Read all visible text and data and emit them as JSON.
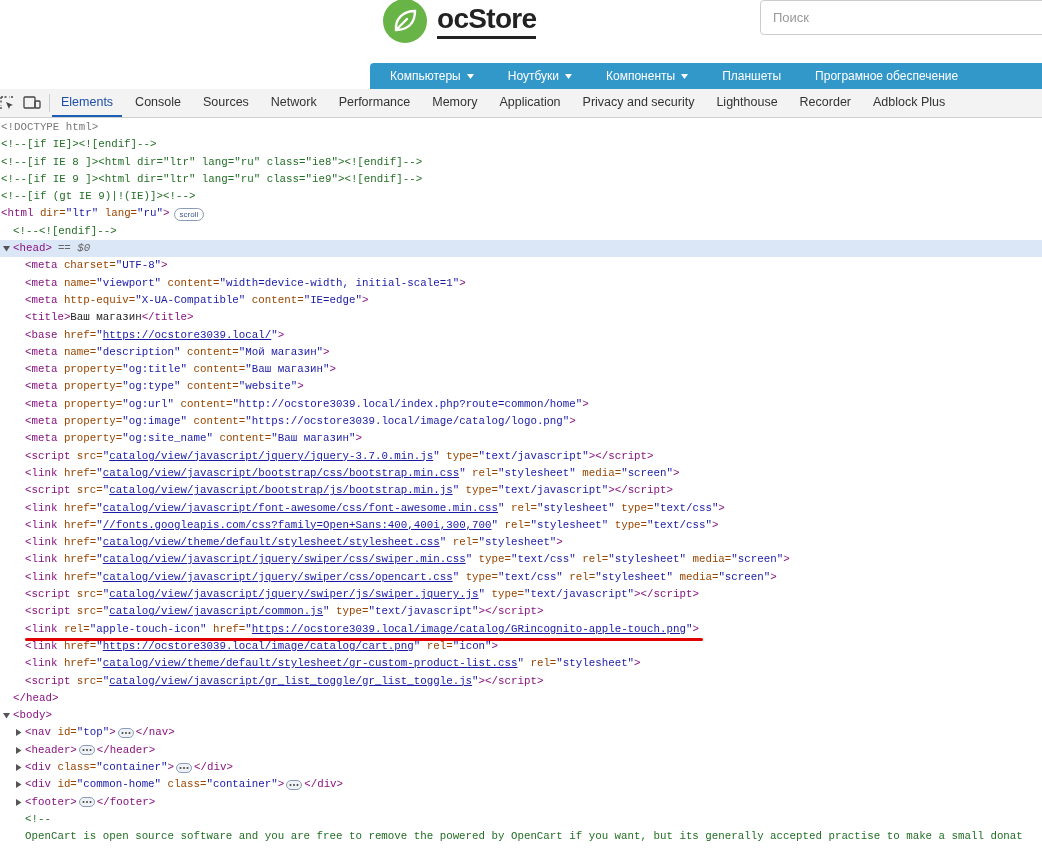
{
  "store_header": {
    "logo_text": "ocStore",
    "search": {
      "placeholder": "Поиск"
    },
    "menu": [
      {
        "label": "Компьютеры",
        "dropdown": true
      },
      {
        "label": "Ноутбуки",
        "dropdown": true
      },
      {
        "label": "Компоненты",
        "dropdown": true
      },
      {
        "label": "Планшеты",
        "dropdown": false
      },
      {
        "label": "Програмное обеспечение",
        "dropdown": false
      }
    ]
  },
  "devtools": {
    "tabs": [
      {
        "label": "Elements",
        "selected": true
      },
      {
        "label": "Console",
        "selected": false
      },
      {
        "label": "Sources",
        "selected": false
      },
      {
        "label": "Network",
        "selected": false
      },
      {
        "label": "Performance",
        "selected": false
      },
      {
        "label": "Memory",
        "selected": false
      },
      {
        "label": "Application",
        "selected": false
      },
      {
        "label": "Privacy and security",
        "selected": false
      },
      {
        "label": "Lighthouse",
        "selected": false
      },
      {
        "label": "Recorder",
        "selected": false
      },
      {
        "label": "Adblock Plus",
        "selected": false
      }
    ],
    "dom_tree": [
      {
        "selected": false,
        "underlined": false,
        "tokens": [
          {
            "kind": "doctype",
            "text": "<!DOCTYPE html>"
          }
        ]
      },
      {
        "selected": false,
        "underlined": false,
        "tokens": [
          {
            "kind": "comment",
            "text": "<!--[if IE]><![endif]-->"
          }
        ]
      },
      {
        "selected": false,
        "underlined": false,
        "tokens": [
          {
            "kind": "comment",
            "text": "<!--[if IE 8 ]><html dir=\"ltr\" lang=\"ru\" class=\"ie8\"><![endif]-->"
          }
        ]
      },
      {
        "selected": false,
        "underlined": false,
        "tokens": [
          {
            "kind": "comment",
            "text": "<!--[if IE 9 ]><html dir=\"ltr\" lang=\"ru\" class=\"ie9\"><![endif]-->"
          }
        ]
      },
      {
        "selected": false,
        "underlined": false,
        "tokens": [
          {
            "kind": "comment",
            "text": "<!--[if (gt IE 9)|!(IE)]><!-->"
          }
        ]
      },
      {
        "selected": false,
        "underlined": false,
        "badge": "scroll",
        "tokens": [
          {
            "kind": "tag",
            "text": "<html"
          },
          {
            "kind": "attr",
            "text": " dir="
          },
          {
            "kind": "value",
            "text": "\"ltr\""
          },
          {
            "kind": "attr",
            "text": " lang="
          },
          {
            "kind": "value",
            "text": "\"ru\""
          },
          {
            "kind": "tag",
            "text": ">"
          }
        ],
        "children": [
          {
            "selected": false,
            "underlined": false,
            "tokens": [
              {
                "kind": "comment",
                "text": "<!--<![endif]-->"
              }
            ]
          },
          {
            "selected": true,
            "underlined": false,
            "expanded": true,
            "marker": "== $0",
            "tokens": [
              {
                "kind": "tag",
                "text": "<head>"
              }
            ],
            "closing": [
              {
                "kind": "tag",
                "text": "</head>"
              }
            ],
            "children": [
              {
                "selected": false,
                "underlined": false,
                "tokens": [
                  {
                    "kind": "tag",
                    "text": "<meta"
                  },
                  {
                    "kind": "attr",
                    "text": " charset="
                  },
                  {
                    "kind": "value",
                    "text": "\"UTF-8\""
                  },
                  {
                    "kind": "tag",
                    "text": ">"
                  }
                ]
              },
              {
                "selected": false,
                "underlined": false,
                "tokens": [
                  {
                    "kind": "tag",
                    "text": "<meta"
                  },
                  {
                    "kind": "attr",
                    "text": " name="
                  },
                  {
                    "kind": "value",
                    "text": "\"viewport\""
                  },
                  {
                    "kind": "attr",
                    "text": " content="
                  },
                  {
                    "kind": "value",
                    "text": "\"width=device-width, initial-scale=1\""
                  },
                  {
                    "kind": "tag",
                    "text": ">"
                  }
                ]
              },
              {
                "selected": false,
                "underlined": false,
                "tokens": [
                  {
                    "kind": "tag",
                    "text": "<meta"
                  },
                  {
                    "kind": "attr",
                    "text": " http-equiv="
                  },
                  {
                    "kind": "value",
                    "text": "\"X-UA-Compatible\""
                  },
                  {
                    "kind": "attr",
                    "text": " content="
                  },
                  {
                    "kind": "value",
                    "text": "\"IE=edge\""
                  },
                  {
                    "kind": "tag",
                    "text": ">"
                  }
                ]
              },
              {
                "selected": false,
                "underlined": false,
                "tokens": [
                  {
                    "kind": "tag",
                    "text": "<title>"
                  },
                  {
                    "kind": "text",
                    "text": "Ваш магазин"
                  },
                  {
                    "kind": "tag",
                    "text": "</title>"
                  }
                ]
              },
              {
                "selected": false,
                "underlined": false,
                "tokens": [
                  {
                    "kind": "tag",
                    "text": "<base"
                  },
                  {
                    "kind": "attr",
                    "text": " href="
                  },
                  {
                    "kind": "value",
                    "text": "\""
                  },
                  {
                    "kind": "link",
                    "text": "https://ocstore3039.local/"
                  },
                  {
                    "kind": "value",
                    "text": "\""
                  },
                  {
                    "kind": "tag",
                    "text": ">"
                  }
                ]
              },
              {
                "selected": false,
                "underlined": false,
                "tokens": [
                  {
                    "kind": "tag",
                    "text": "<meta"
                  },
                  {
                    "kind": "attr",
                    "text": " name="
                  },
                  {
                    "kind": "value",
                    "text": "\"description\""
                  },
                  {
                    "kind": "attr",
                    "text": " content="
                  },
                  {
                    "kind": "value",
                    "text": "\"Мой магазин\""
                  },
                  {
                    "kind": "tag",
                    "text": ">"
                  }
                ]
              },
              {
                "selected": false,
                "underlined": false,
                "tokens": [
                  {
                    "kind": "tag",
                    "text": "<meta"
                  },
                  {
                    "kind": "attr",
                    "text": " property="
                  },
                  {
                    "kind": "value",
                    "text": "\"og:title\""
                  },
                  {
                    "kind": "attr",
                    "text": " content="
                  },
                  {
                    "kind": "value",
                    "text": "\"Ваш магазин\""
                  },
                  {
                    "kind": "tag",
                    "text": ">"
                  }
                ]
              },
              {
                "selected": false,
                "underlined": false,
                "tokens": [
                  {
                    "kind": "tag",
                    "text": "<meta"
                  },
                  {
                    "kind": "attr",
                    "text": " property="
                  },
                  {
                    "kind": "value",
                    "text": "\"og:type\""
                  },
                  {
                    "kind": "attr",
                    "text": " content="
                  },
                  {
                    "kind": "value",
                    "text": "\"website\""
                  },
                  {
                    "kind": "tag",
                    "text": ">"
                  }
                ]
              },
              {
                "selected": false,
                "underlined": false,
                "tokens": [
                  {
                    "kind": "tag",
                    "text": "<meta"
                  },
                  {
                    "kind": "attr",
                    "text": " property="
                  },
                  {
                    "kind": "value",
                    "text": "\"og:url\""
                  },
                  {
                    "kind": "attr",
                    "text": " content="
                  },
                  {
                    "kind": "value",
                    "text": "\"http://ocstore3039.local/index.php?route=common/home\""
                  },
                  {
                    "kind": "tag",
                    "text": ">"
                  }
                ]
              },
              {
                "selected": false,
                "underlined": false,
                "tokens": [
                  {
                    "kind": "tag",
                    "text": "<meta"
                  },
                  {
                    "kind": "attr",
                    "text": " property="
                  },
                  {
                    "kind": "value",
                    "text": "\"og:image\""
                  },
                  {
                    "kind": "attr",
                    "text": " content="
                  },
                  {
                    "kind": "value",
                    "text": "\"https://ocstore3039.local/image/catalog/logo.png\""
                  },
                  {
                    "kind": "tag",
                    "text": ">"
                  }
                ]
              },
              {
                "selected": false,
                "underlined": false,
                "tokens": [
                  {
                    "kind": "tag",
                    "text": "<meta"
                  },
                  {
                    "kind": "attr",
                    "text": " property="
                  },
                  {
                    "kind": "value",
                    "text": "\"og:site_name\""
                  },
                  {
                    "kind": "attr",
                    "text": " content="
                  },
                  {
                    "kind": "value",
                    "text": "\"Ваш магазин\""
                  },
                  {
                    "kind": "tag",
                    "text": ">"
                  }
                ]
              },
              {
                "selected": false,
                "underlined": false,
                "tokens": [
                  {
                    "kind": "tag",
                    "text": "<script"
                  },
                  {
                    "kind": "attr",
                    "text": " src="
                  },
                  {
                    "kind": "value",
                    "text": "\""
                  },
                  {
                    "kind": "link",
                    "text": "catalog/view/javascript/jquery/jquery-3.7.0.min.js"
                  },
                  {
                    "kind": "value",
                    "text": "\""
                  },
                  {
                    "kind": "attr",
                    "text": " type="
                  },
                  {
                    "kind": "value",
                    "text": "\"text/javascript\""
                  },
                  {
                    "kind": "tag",
                    "text": "></script>"
                  }
                ]
              },
              {
                "selected": false,
                "underlined": false,
                "tokens": [
                  {
                    "kind": "tag",
                    "text": "<link"
                  },
                  {
                    "kind": "attr",
                    "text": " href="
                  },
                  {
                    "kind": "value",
                    "text": "\""
                  },
                  {
                    "kind": "link",
                    "text": "catalog/view/javascript/bootstrap/css/bootstrap.min.css"
                  },
                  {
                    "kind": "value",
                    "text": "\""
                  },
                  {
                    "kind": "attr",
                    "text": " rel="
                  },
                  {
                    "kind": "value",
                    "text": "\"stylesheet\""
                  },
                  {
                    "kind": "attr",
                    "text": " media="
                  },
                  {
                    "kind": "value",
                    "text": "\"screen\""
                  },
                  {
                    "kind": "tag",
                    "text": ">"
                  }
                ]
              },
              {
                "selected": false,
                "underlined": false,
                "tokens": [
                  {
                    "kind": "tag",
                    "text": "<script"
                  },
                  {
                    "kind": "attr",
                    "text": " src="
                  },
                  {
                    "kind": "value",
                    "text": "\""
                  },
                  {
                    "kind": "link",
                    "text": "catalog/view/javascript/bootstrap/js/bootstrap.min.js"
                  },
                  {
                    "kind": "value",
                    "text": "\""
                  },
                  {
                    "kind": "attr",
                    "text": " type="
                  },
                  {
                    "kind": "value",
                    "text": "\"text/javascript\""
                  },
                  {
                    "kind": "tag",
                    "text": "></script>"
                  }
                ]
              },
              {
                "selected": false,
                "underlined": false,
                "tokens": [
                  {
                    "kind": "tag",
                    "text": "<link"
                  },
                  {
                    "kind": "attr",
                    "text": " href="
                  },
                  {
                    "kind": "value",
                    "text": "\""
                  },
                  {
                    "kind": "link",
                    "text": "catalog/view/javascript/font-awesome/css/font-awesome.min.css"
                  },
                  {
                    "kind": "value",
                    "text": "\""
                  },
                  {
                    "kind": "attr",
                    "text": " rel="
                  },
                  {
                    "kind": "value",
                    "text": "\"stylesheet\""
                  },
                  {
                    "kind": "attr",
                    "text": " type="
                  },
                  {
                    "kind": "value",
                    "text": "\"text/css\""
                  },
                  {
                    "kind": "tag",
                    "text": ">"
                  }
                ]
              },
              {
                "selected": false,
                "underlined": false,
                "tokens": [
                  {
                    "kind": "tag",
                    "text": "<link"
                  },
                  {
                    "kind": "attr",
                    "text": " href="
                  },
                  {
                    "kind": "value",
                    "text": "\""
                  },
                  {
                    "kind": "link",
                    "text": "//fonts.googleapis.com/css?family=Open+Sans:400,400i,300,700"
                  },
                  {
                    "kind": "value",
                    "text": "\""
                  },
                  {
                    "kind": "attr",
                    "text": " rel="
                  },
                  {
                    "kind": "value",
                    "text": "\"stylesheet\""
                  },
                  {
                    "kind": "attr",
                    "text": " type="
                  },
                  {
                    "kind": "value",
                    "text": "\"text/css\""
                  },
                  {
                    "kind": "tag",
                    "text": ">"
                  }
                ]
              },
              {
                "selected": false,
                "underlined": false,
                "tokens": [
                  {
                    "kind": "tag",
                    "text": "<link"
                  },
                  {
                    "kind": "attr",
                    "text": " href="
                  },
                  {
                    "kind": "value",
                    "text": "\""
                  },
                  {
                    "kind": "link",
                    "text": "catalog/view/theme/default/stylesheet/stylesheet.css"
                  },
                  {
                    "kind": "value",
                    "text": "\""
                  },
                  {
                    "kind": "attr",
                    "text": " rel="
                  },
                  {
                    "kind": "value",
                    "text": "\"stylesheet\""
                  },
                  {
                    "kind": "tag",
                    "text": ">"
                  }
                ]
              },
              {
                "selected": false,
                "underlined": false,
                "tokens": [
                  {
                    "kind": "tag",
                    "text": "<link"
                  },
                  {
                    "kind": "attr",
                    "text": " href="
                  },
                  {
                    "kind": "value",
                    "text": "\""
                  },
                  {
                    "kind": "link",
                    "text": "catalog/view/javascript/jquery/swiper/css/swiper.min.css"
                  },
                  {
                    "kind": "value",
                    "text": "\""
                  },
                  {
                    "kind": "attr",
                    "text": " type="
                  },
                  {
                    "kind": "value",
                    "text": "\"text/css\""
                  },
                  {
                    "kind": "attr",
                    "text": " rel="
                  },
                  {
                    "kind": "value",
                    "text": "\"stylesheet\""
                  },
                  {
                    "kind": "attr",
                    "text": " media="
                  },
                  {
                    "kind": "value",
                    "text": "\"screen\""
                  },
                  {
                    "kind": "tag",
                    "text": ">"
                  }
                ]
              },
              {
                "selected": false,
                "underlined": false,
                "tokens": [
                  {
                    "kind": "tag",
                    "text": "<link"
                  },
                  {
                    "kind": "attr",
                    "text": " href="
                  },
                  {
                    "kind": "value",
                    "text": "\""
                  },
                  {
                    "kind": "link",
                    "text": "catalog/view/javascript/jquery/swiper/css/opencart.css"
                  },
                  {
                    "kind": "value",
                    "text": "\""
                  },
                  {
                    "kind": "attr",
                    "text": " type="
                  },
                  {
                    "kind": "value",
                    "text": "\"text/css\""
                  },
                  {
                    "kind": "attr",
                    "text": " rel="
                  },
                  {
                    "kind": "value",
                    "text": "\"stylesheet\""
                  },
                  {
                    "kind": "attr",
                    "text": " media="
                  },
                  {
                    "kind": "value",
                    "text": "\"screen\""
                  },
                  {
                    "kind": "tag",
                    "text": ">"
                  }
                ]
              },
              {
                "selected": false,
                "underlined": false,
                "tokens": [
                  {
                    "kind": "tag",
                    "text": "<script"
                  },
                  {
                    "kind": "attr",
                    "text": " src="
                  },
                  {
                    "kind": "value",
                    "text": "\""
                  },
                  {
                    "kind": "link",
                    "text": "catalog/view/javascript/jquery/swiper/js/swiper.jquery.js"
                  },
                  {
                    "kind": "value",
                    "text": "\""
                  },
                  {
                    "kind": "attr",
                    "text": " type="
                  },
                  {
                    "kind": "value",
                    "text": "\"text/javascript\""
                  },
                  {
                    "kind": "tag",
                    "text": "></script>"
                  }
                ]
              },
              {
                "selected": false,
                "underlined": false,
                "tokens": [
                  {
                    "kind": "tag",
                    "text": "<script"
                  },
                  {
                    "kind": "attr",
                    "text": " src="
                  },
                  {
                    "kind": "value",
                    "text": "\""
                  },
                  {
                    "kind": "link",
                    "text": "catalog/view/javascript/common.js"
                  },
                  {
                    "kind": "value",
                    "text": "\""
                  },
                  {
                    "kind": "attr",
                    "text": " type="
                  },
                  {
                    "kind": "value",
                    "text": "\"text/javascript\""
                  },
                  {
                    "kind": "tag",
                    "text": "></script>"
                  }
                ]
              },
              {
                "selected": false,
                "underlined": true,
                "tokens": [
                  {
                    "kind": "tag",
                    "text": "<link"
                  },
                  {
                    "kind": "attr",
                    "text": " rel="
                  },
                  {
                    "kind": "value",
                    "text": "\"apple-touch-icon\""
                  },
                  {
                    "kind": "attr",
                    "text": " href="
                  },
                  {
                    "kind": "value",
                    "text": "\""
                  },
                  {
                    "kind": "link",
                    "text": "https://ocstore3039.local/image/catalog/GRincognito-apple-touch.png"
                  },
                  {
                    "kind": "value",
                    "text": "\""
                  },
                  {
                    "kind": "tag",
                    "text": ">"
                  }
                ]
              },
              {
                "selected": false,
                "underlined": false,
                "tokens": [
                  {
                    "kind": "tag",
                    "text": "<link"
                  },
                  {
                    "kind": "attr",
                    "text": " href="
                  },
                  {
                    "kind": "value",
                    "text": "\""
                  },
                  {
                    "kind": "link",
                    "text": "https://ocstore3039.local/image/catalog/cart.png"
                  },
                  {
                    "kind": "value",
                    "text": "\""
                  },
                  {
                    "kind": "attr",
                    "text": " rel="
                  },
                  {
                    "kind": "value",
                    "text": "\"icon\""
                  },
                  {
                    "kind": "tag",
                    "text": ">"
                  }
                ]
              },
              {
                "selected": false,
                "underlined": false,
                "tokens": [
                  {
                    "kind": "tag",
                    "text": "<link"
                  },
                  {
                    "kind": "attr",
                    "text": " href="
                  },
                  {
                    "kind": "value",
                    "text": "\""
                  },
                  {
                    "kind": "link",
                    "text": "catalog/view/theme/default/stylesheet/gr-custom-product-list.css"
                  },
                  {
                    "kind": "value",
                    "text": "\""
                  },
                  {
                    "kind": "attr",
                    "text": " rel="
                  },
                  {
                    "kind": "value",
                    "text": "\"stylesheet\""
                  },
                  {
                    "kind": "tag",
                    "text": ">"
                  }
                ]
              },
              {
                "selected": false,
                "underlined": false,
                "tokens": [
                  {
                    "kind": "tag",
                    "text": "<script"
                  },
                  {
                    "kind": "attr",
                    "text": " src="
                  },
                  {
                    "kind": "value",
                    "text": "\""
                  },
                  {
                    "kind": "link",
                    "text": "catalog/view/javascript/gr_list_toggle/gr_list_toggle.js"
                  },
                  {
                    "kind": "value",
                    "text": "\""
                  },
                  {
                    "kind": "tag",
                    "text": "></script>"
                  }
                ]
              }
            ]
          },
          {
            "selected": false,
            "underlined": false,
            "expanded": true,
            "tokens": [
              {
                "kind": "tag",
                "text": "<body>"
              }
            ],
            "children": [
              {
                "selected": false,
                "underlined": false,
                "expanded": false,
                "tokens": [
                  {
                    "kind": "tag",
                    "text": "<nav"
                  },
                  {
                    "kind": "attr",
                    "text": " id="
                  },
                  {
                    "kind": "value",
                    "text": "\"top\""
                  },
                  {
                    "kind": "tag",
                    "text": ">"
                  }
                ],
                "closing": [
                  {
                    "kind": "tag",
                    "text": "</nav>"
                  }
                ]
              },
              {
                "selected": false,
                "underlined": false,
                "expanded": false,
                "tokens": [
                  {
                    "kind": "tag",
                    "text": "<header>"
                  }
                ],
                "closing": [
                  {
                    "kind": "tag",
                    "text": "</header>"
                  }
                ]
              },
              {
                "selected": false,
                "underlined": false,
                "expanded": false,
                "tokens": [
                  {
                    "kind": "tag",
                    "text": "<div"
                  },
                  {
                    "kind": "attr",
                    "text": " class="
                  },
                  {
                    "kind": "value",
                    "text": "\"container\""
                  },
                  {
                    "kind": "tag",
                    "text": ">"
                  }
                ],
                "closing": [
                  {
                    "kind": "tag",
                    "text": "</div>"
                  }
                ]
              },
              {
                "selected": false,
                "underlined": false,
                "expanded": false,
                "tokens": [
                  {
                    "kind": "tag",
                    "text": "<div"
                  },
                  {
                    "kind": "attr",
                    "text": " id="
                  },
                  {
                    "kind": "value",
                    "text": "\"common-home\""
                  },
                  {
                    "kind": "attr",
                    "text": " class="
                  },
                  {
                    "kind": "value",
                    "text": "\"container\""
                  },
                  {
                    "kind": "tag",
                    "text": ">"
                  }
                ],
                "closing": [
                  {
                    "kind": "tag",
                    "text": "</div>"
                  }
                ]
              },
              {
                "selected": false,
                "underlined": false,
                "expanded": false,
                "tokens": [
                  {
                    "kind": "tag",
                    "text": "<footer>"
                  }
                ],
                "closing": [
                  {
                    "kind": "tag",
                    "text": "</footer>"
                  }
                ]
              },
              {
                "selected": false,
                "underlined": false,
                "tokens": [
                  {
                    "kind": "comment",
                    "text": "<!--"
                  }
                ],
                "continuation": [
                  {
                    "kind": "comment",
                    "text": "OpenCart is open source software and you are free to remove the powered by OpenCart if you want, but its generally accepted practise to make a small donat"
                  }
                ]
              }
            ]
          }
        ]
      }
    ]
  }
}
